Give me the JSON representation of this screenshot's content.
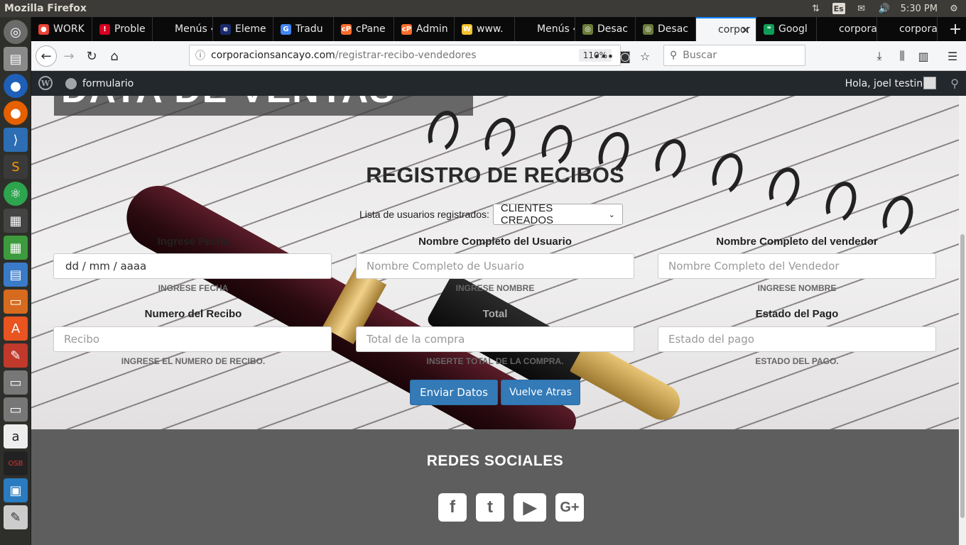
{
  "os": {
    "app_title": "Mozilla Firefox",
    "keyboard_layout": "Es",
    "clock": "5:30 PM"
  },
  "tabs": [
    {
      "label": "WORK",
      "fav_color": "#ea4335",
      "fav_glyph": "●"
    },
    {
      "label": "Proble",
      "fav_color": "#d70022",
      "fav_glyph": "!"
    },
    {
      "label": "Menús ‹ fo",
      "fav_color": "#0a0a0a",
      "fav_glyph": ""
    },
    {
      "label": "Eleme",
      "fav_color": "#1a2b6d",
      "fav_glyph": "e"
    },
    {
      "label": "Tradu",
      "fav_color": "#4285f4",
      "fav_glyph": "G"
    },
    {
      "label": "cPane",
      "fav_color": "#ff6c2c",
      "fav_glyph": "cP"
    },
    {
      "label": "Admin",
      "fav_color": "#ff6c2c",
      "fav_glyph": "cP"
    },
    {
      "label": "www.",
      "fav_color": "#f2c12e",
      "fav_glyph": "W"
    },
    {
      "label": "Menús ‹ fo",
      "fav_color": "#0a0a0a",
      "fav_glyph": ""
    },
    {
      "label": "Desac",
      "fav_color": "#6b7b3a",
      "fav_glyph": "◎"
    },
    {
      "label": "Desac",
      "fav_color": "#6b7b3a",
      "fav_glyph": "◎"
    },
    {
      "label": "corpor",
      "fav_color": "#f5f6f7",
      "fav_glyph": "",
      "active": true
    },
    {
      "label": "Googl",
      "fav_color": "#0f9d58",
      "fav_glyph": "❝"
    },
    {
      "label": "corporaci",
      "fav_color": "#0a0a0a",
      "fav_glyph": ""
    },
    {
      "label": "corporaci",
      "fav_color": "#0a0a0a",
      "fav_glyph": ""
    }
  ],
  "url": {
    "host": "corporacionsancayo.com",
    "path": "/registrar-recibo-vendedores",
    "zoom": "110%"
  },
  "search": {
    "placeholder": "Buscar"
  },
  "wp_admin": {
    "site_name": "formulario",
    "greeting": "Hola, joel testing"
  },
  "hero": {
    "banner_text": "DATA DE VENTAS"
  },
  "form": {
    "title": "REGISTRO DE RECIBOS",
    "user_list_label": "Lista de usuarios registrados:",
    "user_list_value": "CLIENTES CREADOS",
    "fields": [
      {
        "label": "Ingrese Fecha",
        "placeholder": "dd / mm / aaaa",
        "help": "INGRESE FECHA"
      },
      {
        "label": "Nombre Completo del Usuario",
        "placeholder": "Nombre Completo de Usuario",
        "help": "INGRESE NOMBRE"
      },
      {
        "label": "Nombre Completo del vendedor",
        "placeholder": "Nombre Completo del Vendedor",
        "help": "INGRESE NOMBRE"
      },
      {
        "label": "Numero del Recibo",
        "placeholder": "Recibo",
        "help": "INGRESE EL NUMERO DE RECIBO."
      },
      {
        "label": "Total",
        "placeholder": "Total de la compra",
        "help": "INSERTE TOTAL DE LA COMPRA."
      },
      {
        "label": "Estado del Pago",
        "placeholder": "Estado del pago",
        "help": "ESTADO DEL PAGO."
      }
    ],
    "submit_label": "Enviar Datos",
    "back_label": "Vuelve Atras"
  },
  "footer": {
    "title": "REDES SOCIALES",
    "social": [
      {
        "name": "facebook",
        "glyph": "f"
      },
      {
        "name": "twitter",
        "glyph": "t"
      },
      {
        "name": "youtube",
        "glyph": "▶"
      },
      {
        "name": "google-plus",
        "glyph": "G+"
      }
    ]
  },
  "colors": {
    "firefox_tabstrip": "#0a0a0a",
    "active_tab_accent": "#0a84ff",
    "wp_admin_bar": "#23282d",
    "primary_button": "#337ab7",
    "footer_bg": "#5e5e5e"
  }
}
